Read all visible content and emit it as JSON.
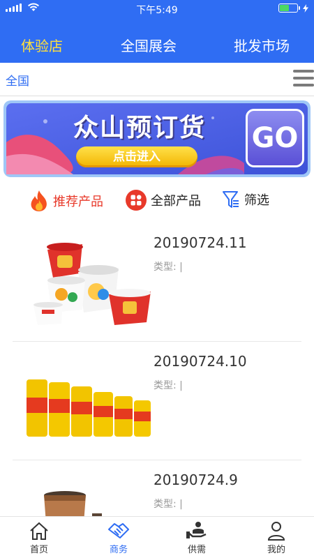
{
  "status_bar": {
    "time": "下午5:49"
  },
  "top_tabs": [
    {
      "label": "体验店",
      "active": true
    },
    {
      "label": "全国展会",
      "active": false
    },
    {
      "label": "批发市场",
      "active": false
    }
  ],
  "location": {
    "region": "全国"
  },
  "banner": {
    "title": "众山预订货",
    "button_label": "点击进入",
    "go_label": "GO"
  },
  "filters": [
    {
      "label": "推荐产品",
      "icon": "flame-icon",
      "active": true
    },
    {
      "label": "全部产品",
      "icon": "grid-icon",
      "active": false
    },
    {
      "label": "筛选",
      "icon": "filter-icon",
      "active": false
    }
  ],
  "products": [
    {
      "title": "20190724.11",
      "type_label": "类型: |",
      "image": "paper-bowls"
    },
    {
      "title": "20190724.10",
      "type_label": "类型: |",
      "image": "cling-film-rolls"
    },
    {
      "title": "20190724.9",
      "type_label": "类型: |",
      "image": "kraft-bowls"
    }
  ],
  "tab_bar": [
    {
      "label": "首页",
      "icon": "home-icon",
      "active": false
    },
    {
      "label": "商务",
      "icon": "handshake-icon",
      "active": true
    },
    {
      "label": "供需",
      "icon": "supply-demand-icon",
      "active": false
    },
    {
      "label": "我的",
      "icon": "user-icon",
      "active": false
    }
  ],
  "colors": {
    "primary_blue": "#2f6df3",
    "active_tab_yellow": "#ffe03d",
    "recommend_red": "#e8392a"
  }
}
